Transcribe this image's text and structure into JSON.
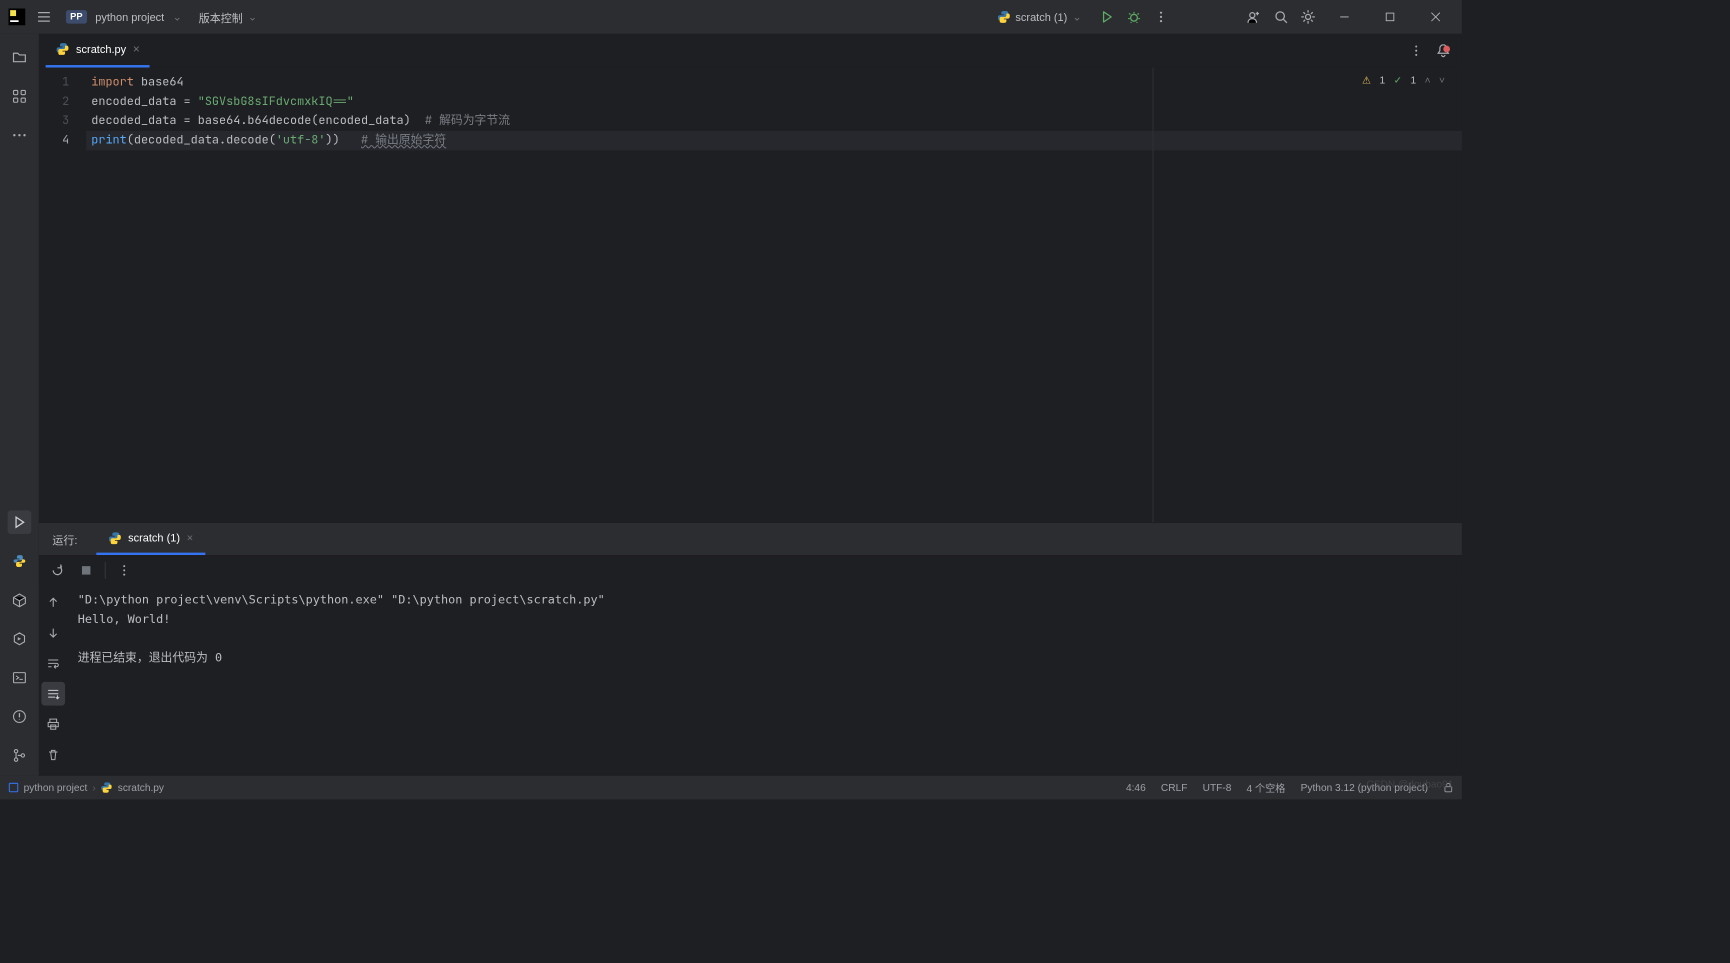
{
  "titlebar": {
    "project_badge": "PP",
    "project_name": "python project",
    "vcs_label": "版本控制",
    "run_config": "scratch (1)"
  },
  "editor": {
    "tab_name": "scratch.py",
    "inspection_warn_count": "1",
    "inspection_ok_count": "1",
    "lines": {
      "l1_kw": "import",
      "l1_mod": " base64",
      "l2_a": "encoded_data = ",
      "l2_str": "\"SGVsbG8sIFdvcmxkIQ==\"",
      "l3_a": "decoded_data = base64.b64decode(encoded_data)  ",
      "l3_cmt": "# 解码为字节流",
      "l4_fn": "print",
      "l4_a": "(decoded_data.decode(",
      "l4_str": "'utf-8'",
      "l4_b": "))   ",
      "l4_cmt": "# 输出原始字符"
    },
    "gutter": [
      "1",
      "2",
      "3",
      "4"
    ]
  },
  "run_panel": {
    "title": "运行:",
    "tab": "scratch (1)",
    "output_line1": "\"D:\\python project\\venv\\Scripts\\python.exe\" \"D:\\python project\\scratch.py\" ",
    "output_line2": "Hello, World!",
    "output_line3": "",
    "output_line4": "进程已结束，退出代码为 0"
  },
  "breadcrumb": {
    "root": "python project",
    "file": "scratch.py"
  },
  "status": {
    "pos": "4:46",
    "eol": "CRLF",
    "enc": "UTF-8",
    "indent": "4 个空格",
    "interp": "Python 3.12 (python project)"
  },
  "watermark": "CSDN @doubao91"
}
